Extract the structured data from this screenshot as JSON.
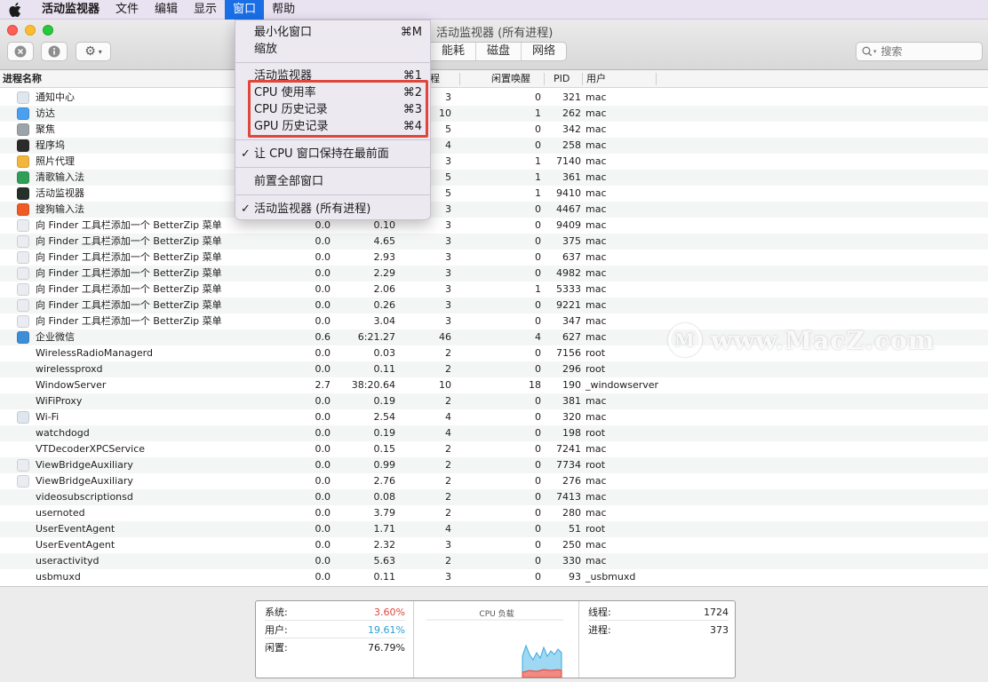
{
  "menubar": {
    "app": "活动监视器",
    "items": [
      "文件",
      "编辑",
      "显示",
      "窗口",
      "帮助"
    ],
    "active_index": 3
  },
  "window": {
    "title": "活动监视器 (所有进程)",
    "tabs": [
      "能耗",
      "磁盘",
      "网络"
    ],
    "search_placeholder": "搜索"
  },
  "table": {
    "headers": {
      "name": "进程名称",
      "threads": "程",
      "idle_wakeups": "闲置唤醒",
      "pid": "PID",
      "user": "用户"
    },
    "rows": [
      {
        "name": "通知中心",
        "cpu": "",
        "time": "",
        "threads": "3",
        "wake": "0",
        "pid": "321",
        "user": "mac",
        "icon": "notification-center-icon",
        "color": "#dfe6ee"
      },
      {
        "name": "访达",
        "cpu": "",
        "time": "",
        "threads": "10",
        "wake": "1",
        "pid": "262",
        "user": "mac",
        "icon": "finder-icon",
        "color": "#4a9ff0"
      },
      {
        "name": "聚焦",
        "cpu": "",
        "time": "",
        "threads": "5",
        "wake": "0",
        "pid": "342",
        "user": "mac",
        "icon": "spotlight-icon",
        "color": "#9da3aa"
      },
      {
        "name": "程序坞",
        "cpu": "",
        "time": "",
        "threads": "4",
        "wake": "0",
        "pid": "258",
        "user": "mac",
        "icon": "dock-icon",
        "color": "#2b2b2b"
      },
      {
        "name": "照片代理",
        "cpu": "",
        "time": "",
        "threads": "3",
        "wake": "1",
        "pid": "7140",
        "user": "mac",
        "icon": "photos-icon",
        "color": "#f3b63c"
      },
      {
        "name": "清歌输入法",
        "cpu": "",
        "time": "",
        "threads": "5",
        "wake": "1",
        "pid": "361",
        "user": "mac",
        "icon": "qingge-input-icon",
        "color": "#2f9e57"
      },
      {
        "name": "活动监视器",
        "cpu": "",
        "time": "",
        "threads": "5",
        "wake": "1",
        "pid": "9410",
        "user": "mac",
        "icon": "activity-monitor-icon",
        "color": "#26302b"
      },
      {
        "name": "搜狗输入法",
        "cpu": "",
        "time": "",
        "threads": "3",
        "wake": "0",
        "pid": "4467",
        "user": "mac",
        "icon": "sogou-input-icon",
        "color": "#ef5a25"
      },
      {
        "name": "向 Finder 工具栏添加一个 BetterZip 菜单",
        "cpu": "0.0",
        "time": "0.10",
        "threads": "3",
        "wake": "0",
        "pid": "9409",
        "user": "mac",
        "icon": "generic-app-icon",
        "color": "#e9edf2"
      },
      {
        "name": "向 Finder 工具栏添加一个 BetterZip 菜单",
        "cpu": "0.0",
        "time": "4.65",
        "threads": "3",
        "wake": "0",
        "pid": "375",
        "user": "mac",
        "icon": "generic-app-icon",
        "color": "#e9edf2"
      },
      {
        "name": "向 Finder 工具栏添加一个 BetterZip 菜单",
        "cpu": "0.0",
        "time": "2.93",
        "threads": "3",
        "wake": "0",
        "pid": "637",
        "user": "mac",
        "icon": "generic-app-icon",
        "color": "#e9edf2"
      },
      {
        "name": "向 Finder 工具栏添加一个 BetterZip 菜单",
        "cpu": "0.0",
        "time": "2.29",
        "threads": "3",
        "wake": "0",
        "pid": "4982",
        "user": "mac",
        "icon": "generic-app-icon",
        "color": "#e9edf2"
      },
      {
        "name": "向 Finder 工具栏添加一个 BetterZip 菜单",
        "cpu": "0.0",
        "time": "2.06",
        "threads": "3",
        "wake": "1",
        "pid": "5333",
        "user": "mac",
        "icon": "generic-app-icon",
        "color": "#e9edf2"
      },
      {
        "name": "向 Finder 工具栏添加一个 BetterZip 菜单",
        "cpu": "0.0",
        "time": "0.26",
        "threads": "3",
        "wake": "0",
        "pid": "9221",
        "user": "mac",
        "icon": "generic-app-icon",
        "color": "#e9edf2"
      },
      {
        "name": "向 Finder 工具栏添加一个 BetterZip 菜单",
        "cpu": "0.0",
        "time": "3.04",
        "threads": "3",
        "wake": "0",
        "pid": "347",
        "user": "mac",
        "icon": "generic-app-icon",
        "color": "#e9edf2"
      },
      {
        "name": "企业微信",
        "cpu": "0.6",
        "time": "6:21.27",
        "threads": "46",
        "wake": "4",
        "pid": "627",
        "user": "mac",
        "icon": "wecom-icon",
        "color": "#3d8ed8"
      },
      {
        "name": "WirelessRadioManagerd",
        "cpu": "0.0",
        "time": "0.03",
        "threads": "2",
        "wake": "0",
        "pid": "7156",
        "user": "root",
        "icon": "",
        "color": ""
      },
      {
        "name": "wirelessproxd",
        "cpu": "0.0",
        "time": "0.11",
        "threads": "2",
        "wake": "0",
        "pid": "296",
        "user": "root",
        "icon": "",
        "color": ""
      },
      {
        "name": "WindowServer",
        "cpu": "2.7",
        "time": "38:20.64",
        "threads": "10",
        "wake": "18",
        "pid": "190",
        "user": "_windowserver",
        "icon": "",
        "color": ""
      },
      {
        "name": "WiFiProxy",
        "cpu": "0.0",
        "time": "0.19",
        "threads": "2",
        "wake": "0",
        "pid": "381",
        "user": "mac",
        "icon": "",
        "color": ""
      },
      {
        "name": "Wi-Fi",
        "cpu": "0.0",
        "time": "2.54",
        "threads": "4",
        "wake": "0",
        "pid": "320",
        "user": "mac",
        "icon": "wifi-app-icon",
        "color": "#dfe6ee"
      },
      {
        "name": "watchdogd",
        "cpu": "0.0",
        "time": "0.19",
        "threads": "4",
        "wake": "0",
        "pid": "198",
        "user": "root",
        "icon": "",
        "color": ""
      },
      {
        "name": "VTDecoderXPCService",
        "cpu": "0.0",
        "time": "0.15",
        "threads": "2",
        "wake": "0",
        "pid": "7241",
        "user": "mac",
        "icon": "",
        "color": ""
      },
      {
        "name": "ViewBridgeAuxiliary",
        "cpu": "0.0",
        "time": "0.99",
        "threads": "2",
        "wake": "0",
        "pid": "7734",
        "user": "root",
        "icon": "generic-app-icon",
        "color": "#e9edf2"
      },
      {
        "name": "ViewBridgeAuxiliary",
        "cpu": "0.0",
        "time": "2.76",
        "threads": "2",
        "wake": "0",
        "pid": "276",
        "user": "mac",
        "icon": "generic-app-icon",
        "color": "#e9edf2"
      },
      {
        "name": "videosubscriptionsd",
        "cpu": "0.0",
        "time": "0.08",
        "threads": "2",
        "wake": "0",
        "pid": "7413",
        "user": "mac",
        "icon": "",
        "color": ""
      },
      {
        "name": "usernoted",
        "cpu": "0.0",
        "time": "3.79",
        "threads": "2",
        "wake": "0",
        "pid": "280",
        "user": "mac",
        "icon": "",
        "color": ""
      },
      {
        "name": "UserEventAgent",
        "cpu": "0.0",
        "time": "1.71",
        "threads": "4",
        "wake": "0",
        "pid": "51",
        "user": "root",
        "icon": "",
        "color": ""
      },
      {
        "name": "UserEventAgent",
        "cpu": "0.0",
        "time": "2.32",
        "threads": "3",
        "wake": "0",
        "pid": "250",
        "user": "mac",
        "icon": "",
        "color": ""
      },
      {
        "name": "useractivityd",
        "cpu": "0.0",
        "time": "5.63",
        "threads": "2",
        "wake": "0",
        "pid": "330",
        "user": "mac",
        "icon": "",
        "color": ""
      },
      {
        "name": "usbmuxd",
        "cpu": "0.0",
        "time": "0.11",
        "threads": "3",
        "wake": "0",
        "pid": "93",
        "user": "_usbmuxd",
        "icon": "",
        "color": ""
      }
    ]
  },
  "window_menu": {
    "minimize": {
      "label": "最小化窗口",
      "shortcut": "⌘M"
    },
    "zoom": {
      "label": "缩放"
    },
    "activity_monitor": {
      "label": "活动监视器",
      "shortcut": "⌘1"
    },
    "cpu_usage": {
      "label": "CPU 使用率",
      "shortcut": "⌘2"
    },
    "cpu_history": {
      "label": "CPU 历史记录",
      "shortcut": "⌘3"
    },
    "gpu_history": {
      "label": "GPU 历史记录",
      "shortcut": "⌘4"
    },
    "keep_on_top": {
      "label": "让 CPU 窗口保持在最前面",
      "checked": true
    },
    "bring_all_front": {
      "label": "前置全部窗口"
    },
    "all_processes": {
      "label": "活动监视器 (所有进程)",
      "checked": true
    },
    "check_glyph": "✓"
  },
  "stats": {
    "system": {
      "label": "系统:",
      "value": "3.60%",
      "color": "#e0463a"
    },
    "user": {
      "label": "用户:",
      "value": "19.61%",
      "color": "#2a9fd6"
    },
    "idle": {
      "label": "闲置:",
      "value": "76.79%"
    },
    "chart_title": "CPU 负载",
    "threads": {
      "label": "线程:",
      "value": "1724"
    },
    "processes": {
      "label": "进程:",
      "value": "373"
    }
  },
  "watermark": {
    "text": "www.MacZ.com",
    "logo": "M"
  }
}
